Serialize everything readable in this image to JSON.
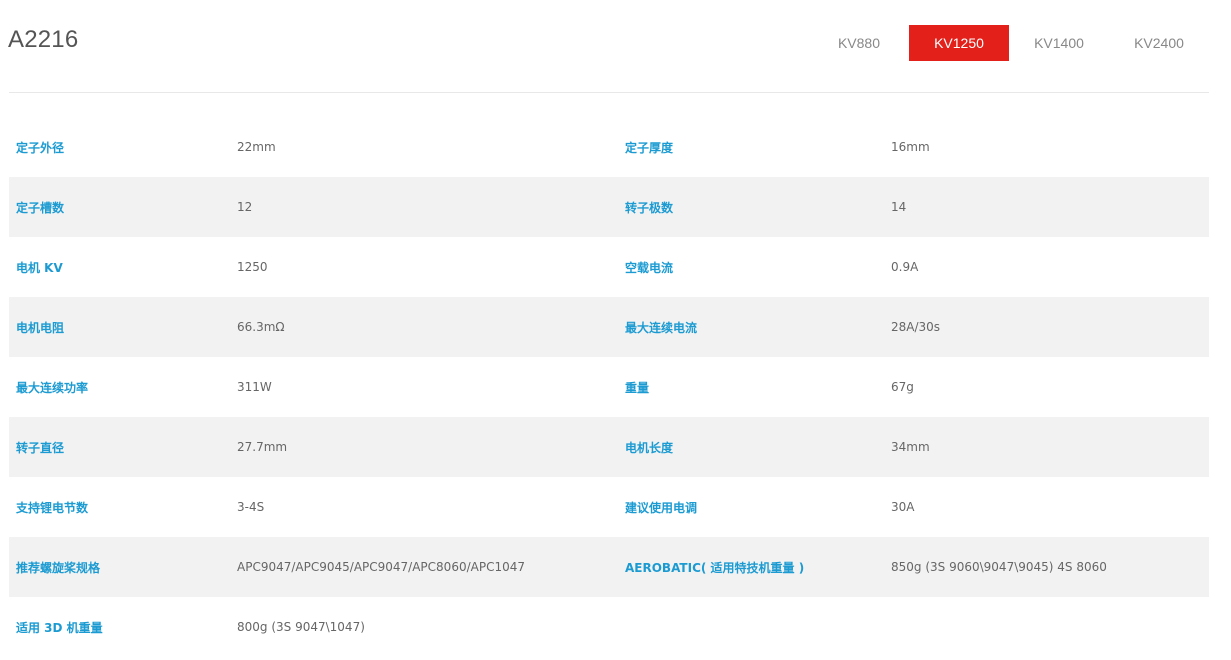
{
  "product": {
    "title": "A2216"
  },
  "kv_tabs": [
    {
      "label": "KV880",
      "active": false
    },
    {
      "label": "KV1250",
      "active": true
    },
    {
      "label": "KV1400",
      "active": false
    },
    {
      "label": "KV2400",
      "active": false
    }
  ],
  "colors": {
    "accent": "#e3201a",
    "label_blue": "#1c9bd2",
    "row_shade": "#f2f2f2"
  },
  "specs": [
    {
      "l1": "定子外径",
      "v1": "22mm",
      "l2": "定子厚度",
      "v2": "16mm"
    },
    {
      "l1": "定子槽数",
      "v1": "12",
      "l2": "转子极数",
      "v2": "14"
    },
    {
      "l1": "电机 KV",
      "v1": "1250",
      "l2": "空载电流",
      "v2": "0.9A"
    },
    {
      "l1": "电机电阻",
      "v1": "66.3mΩ",
      "l2": "最大连续电流",
      "v2": "28A/30s"
    },
    {
      "l1": "最大连续功率",
      "v1": "311W",
      "l2": "重量",
      "v2": "67g"
    },
    {
      "l1": "转子直径",
      "v1": "27.7mm",
      "l2": "电机长度",
      "v2": "34mm"
    },
    {
      "l1": "支持锂电节数",
      "v1": "3-4S",
      "l2": "建议使用电调",
      "v2": "30A"
    },
    {
      "l1": "推荐螺旋桨规格",
      "v1": "APC9047/APC9045/APC9047/APC8060/APC1047",
      "l2": "AEROBATIC( 适用特技机重量 )",
      "v2": "850g (3S 9060\\9047\\9045) 4S 8060"
    },
    {
      "l1": "适用 3D 机重量",
      "v1": "800g (3S 9047\\1047)",
      "l2": "",
      "v2": ""
    }
  ]
}
